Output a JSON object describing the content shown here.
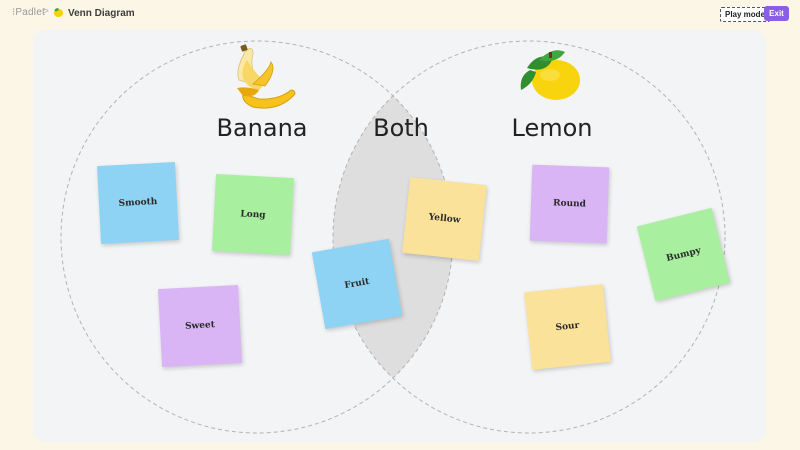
{
  "header": {
    "brand": "⁝Padlet",
    "separator": ">",
    "title": "Venn Diagram",
    "play_mode_label": "Play mode",
    "exit_label": "Exit"
  },
  "venn": {
    "left_heading": "Banana",
    "center_heading": "Both",
    "right_heading": "Lemon"
  },
  "notes": {
    "smooth": "Smooth",
    "long": "Long",
    "sweet": "Sweet",
    "fruit": "Fruit",
    "yellow": "Yellow",
    "round": "Round",
    "sour": "Sour",
    "bumpy": "Bumpy"
  },
  "colors": {
    "accent": "#8a5ee6",
    "note_blue": "#8fd3f4",
    "note_green": "#a8ef9f",
    "note_purple": "#d9b5f5",
    "note_yellow": "#fbe29a"
  },
  "icons": [
    "lemon-icon",
    "banana-icon"
  ]
}
